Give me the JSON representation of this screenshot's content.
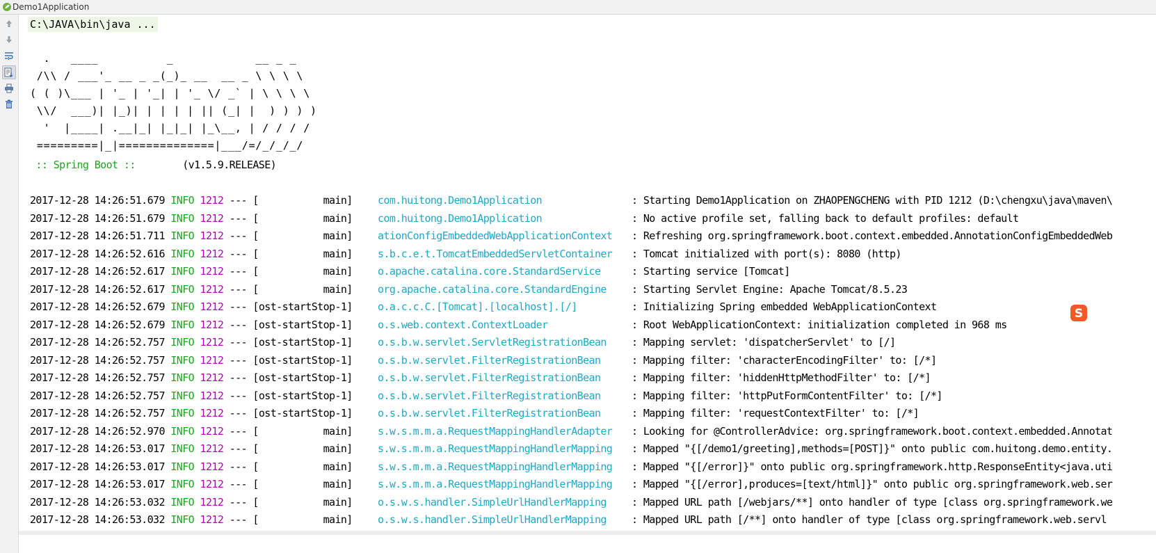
{
  "window": {
    "title": "Demo1Application"
  },
  "toolbar": {
    "buttons": [
      "arrow-up-icon",
      "arrow-down-icon",
      "soft-wrap-icon",
      "scroll-to-end-icon",
      "print-icon",
      "trash-icon"
    ]
  },
  "console": {
    "command": "C:\\JAVA\\bin\\java ...",
    "banner": [
      "  .   ____          _            __ _ _",
      " /\\\\ / ___'_ __ _ _(_)_ __  __ _ \\ \\ \\ \\",
      "( ( )\\___ | '_ | '_| | '_ \\/ _` | \\ \\ \\ \\",
      " \\\\/  ___)| |_)| | | | | || (_| |  ) ) ) )",
      "  '  |____| .__|_| |_|_| |_\\__, | / / / /",
      " =========|_|==============|___/=/_/_/_/"
    ],
    "boot_label": " :: Spring Boot :: ",
    "boot_version": "       (v1.5.9.RELEASE)",
    "logs": [
      {
        "ts": "2017-12-28 14:26:51.679",
        "level": "INFO",
        "pid": "1212",
        "thread": " --- [           main] ",
        "logger": "com.huitong.Demo1Application",
        "msg": ": Starting Demo1Application on ZHAOPENGCHENG with PID 1212 (D:\\chengxu\\java\\maven\\"
      },
      {
        "ts": "2017-12-28 14:26:51.679",
        "level": "INFO",
        "pid": "1212",
        "thread": " --- [           main] ",
        "logger": "com.huitong.Demo1Application",
        "msg": ": No active profile set, falling back to default profiles: default"
      },
      {
        "ts": "2017-12-28 14:26:51.711",
        "level": "INFO",
        "pid": "1212",
        "thread": " --- [           main] ",
        "logger": "ationConfigEmbeddedWebApplicationContext",
        "msg": ": Refreshing org.springframework.boot.context.embedded.AnnotationConfigEmbeddedWeb"
      },
      {
        "ts": "2017-12-28 14:26:52.616",
        "level": "INFO",
        "pid": "1212",
        "thread": " --- [           main] ",
        "logger": "s.b.c.e.t.TomcatEmbeddedServletContainer",
        "msg": ": Tomcat initialized with port(s): 8080 (http)"
      },
      {
        "ts": "2017-12-28 14:26:52.617",
        "level": "INFO",
        "pid": "1212",
        "thread": " --- [           main] ",
        "logger": "o.apache.catalina.core.StandardService",
        "msg": ": Starting service [Tomcat]"
      },
      {
        "ts": "2017-12-28 14:26:52.617",
        "level": "INFO",
        "pid": "1212",
        "thread": " --- [           main] ",
        "logger": "org.apache.catalina.core.StandardEngine",
        "msg": ": Starting Servlet Engine: Apache Tomcat/8.5.23"
      },
      {
        "ts": "2017-12-28 14:26:52.679",
        "level": "INFO",
        "pid": "1212",
        "thread": " --- [ost-startStop-1] ",
        "logger": "o.a.c.c.C.[Tomcat].[localhost].[/]",
        "msg": ": Initializing Spring embedded WebApplicationContext"
      },
      {
        "ts": "2017-12-28 14:26:52.679",
        "level": "INFO",
        "pid": "1212",
        "thread": " --- [ost-startStop-1] ",
        "logger": "o.s.web.context.ContextLoader",
        "msg": ": Root WebApplicationContext: initialization completed in 968 ms"
      },
      {
        "ts": "2017-12-28 14:26:52.757",
        "level": "INFO",
        "pid": "1212",
        "thread": " --- [ost-startStop-1] ",
        "logger": "o.s.b.w.servlet.ServletRegistrationBean",
        "msg": ": Mapping servlet: 'dispatcherServlet' to [/]"
      },
      {
        "ts": "2017-12-28 14:26:52.757",
        "level": "INFO",
        "pid": "1212",
        "thread": " --- [ost-startStop-1] ",
        "logger": "o.s.b.w.servlet.FilterRegistrationBean",
        "msg": ": Mapping filter: 'characterEncodingFilter' to: [/*]"
      },
      {
        "ts": "2017-12-28 14:26:52.757",
        "level": "INFO",
        "pid": "1212",
        "thread": " --- [ost-startStop-1] ",
        "logger": "o.s.b.w.servlet.FilterRegistrationBean",
        "msg": ": Mapping filter: 'hiddenHttpMethodFilter' to: [/*]"
      },
      {
        "ts": "2017-12-28 14:26:52.757",
        "level": "INFO",
        "pid": "1212",
        "thread": " --- [ost-startStop-1] ",
        "logger": "o.s.b.w.servlet.FilterRegistrationBean",
        "msg": ": Mapping filter: 'httpPutFormContentFilter' to: [/*]"
      },
      {
        "ts": "2017-12-28 14:26:52.757",
        "level": "INFO",
        "pid": "1212",
        "thread": " --- [ost-startStop-1] ",
        "logger": "o.s.b.w.servlet.FilterRegistrationBean",
        "msg": ": Mapping filter: 'requestContextFilter' to: [/*]"
      },
      {
        "ts": "2017-12-28 14:26:52.970",
        "level": "INFO",
        "pid": "1212",
        "thread": " --- [           main] ",
        "logger": "s.w.s.m.m.a.RequestMappingHandlerAdapter",
        "msg": ": Looking for @ControllerAdvice: org.springframework.boot.context.embedded.Annotat"
      },
      {
        "ts": "2017-12-28 14:26:53.017",
        "level": "INFO",
        "pid": "1212",
        "thread": " --- [           main] ",
        "logger": "s.w.s.m.m.a.RequestMappingHandlerMapping",
        "msg": ": Mapped \"{[/demo1/greeting],methods=[POST]}\" onto public com.huitong.demo.entity."
      },
      {
        "ts": "2017-12-28 14:26:53.017",
        "level": "INFO",
        "pid": "1212",
        "thread": " --- [           main] ",
        "logger": "s.w.s.m.m.a.RequestMappingHandlerMapping",
        "msg": ": Mapped \"{[/error]}\" onto public org.springframework.http.ResponseEntity<java.uti"
      },
      {
        "ts": "2017-12-28 14:26:53.017",
        "level": "INFO",
        "pid": "1212",
        "thread": " --- [           main] ",
        "logger": "s.w.s.m.m.a.RequestMappingHandlerMapping",
        "msg": ": Mapped \"{[/error],produces=[text/html]}\" onto public org.springframework.web.ser"
      },
      {
        "ts": "2017-12-28 14:26:53.032",
        "level": "INFO",
        "pid": "1212",
        "thread": " --- [           main] ",
        "logger": "o.s.w.s.handler.SimpleUrlHandlerMapping",
        "msg": ": Mapped URL path [/webjars/**] onto handler of type [class org.springframework.we"
      },
      {
        "ts": "2017-12-28 14:26:53.032",
        "level": "INFO",
        "pid": "1212",
        "thread": " --- [           main] ",
        "logger": "o.s.w.s.handler.SimpleUrlHandlerMapping",
        "msg": ": Mapped URL path [/**] onto handler of type [class org.springframework.web.servl"
      }
    ]
  },
  "colors": {
    "level": "#1ea51e",
    "pid": "#b300b3",
    "logger": "#21a8c7",
    "command_bg": "#eef7e6"
  }
}
